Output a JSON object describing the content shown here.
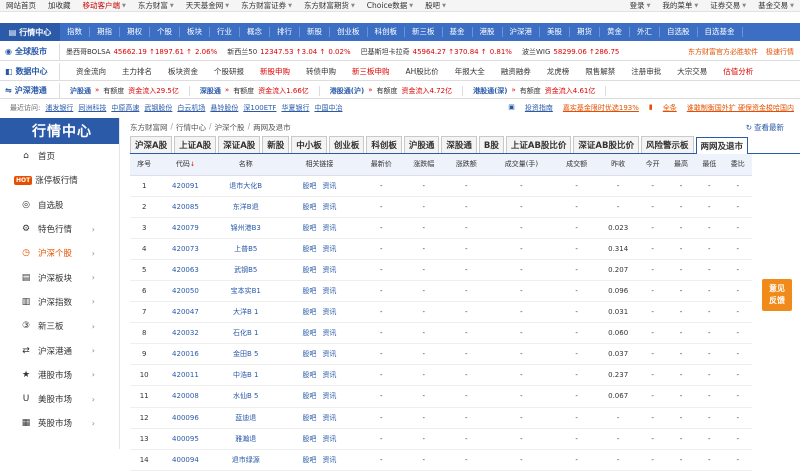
{
  "topbar": {
    "left": [
      "网站首页",
      "加收藏",
      "移动客户端",
      "东方财富",
      "天天基金网",
      "东方财富证券",
      "东方财富期货",
      "Choice数据",
      "股吧"
    ],
    "right": [
      "登录",
      "我的菜单",
      "证券交易",
      "基金交易"
    ]
  },
  "nav": {
    "brand": "行情中心",
    "items": [
      "指数",
      "期指",
      "期权",
      "个股",
      "板块",
      "行业",
      "概念",
      "排行",
      "新股",
      "创业板",
      "科创板",
      "新三板",
      "基金",
      "港股",
      "沪深港",
      "美股",
      "期货",
      "黄金",
      "外汇",
      "自选股",
      "自选基金"
    ]
  },
  "global": {
    "label": "全球股市",
    "tickers": [
      {
        "name": "墨西哥BOLSA",
        "value": "45662.19",
        "chg": "1897.61",
        "pct": "2.06%"
      },
      {
        "name": "新西兰50",
        "value": "12347.53",
        "chg": "3.04",
        "pct": "0.02%"
      },
      {
        "name": "巴基斯坦卡拉奇",
        "value": "45964.27",
        "chg": "370.84",
        "pct": "0.81%"
      },
      {
        "name": "波兰WIG",
        "value": "58299.06",
        "chg": "286.75",
        "pct": ""
      }
    ],
    "promo1": "东方财富官方必胜软件",
    "promo2": "极速行情"
  },
  "datacenter": {
    "label": "数据中心",
    "links": [
      "资金流向",
      "主力排名",
      "板块资金",
      "个股研报",
      "新股申购",
      "转债申购",
      "新三板申购",
      "AH股比价",
      "年报大全",
      "融资融券",
      "龙虎榜",
      "限售解禁",
      "注册审批",
      "大宗交易",
      "估值分析"
    ],
    "red_idx": [
      4,
      6,
      14
    ]
  },
  "hk": {
    "label": "沪深港通",
    "segs": [
      {
        "name": "沪股通",
        "arrow": "»",
        "status": "有额度",
        "flow": "资金流入29.5亿"
      },
      {
        "name": "深股通",
        "arrow": "»",
        "status": "有额度",
        "flow": "资金流入1.66亿"
      },
      {
        "name": "港股通(沪)",
        "arrow": "»",
        "status": "有额度",
        "flow": "资金流入4.72亿"
      },
      {
        "name": "港股通(深)",
        "arrow": "»",
        "status": "有额度",
        "flow": "资金流入4.61亿"
      }
    ]
  },
  "recent": {
    "label": "最近访问:",
    "links": [
      "浦发银行",
      "同洲科技",
      "中原高速",
      "武钢股份",
      "白云机场",
      "悬铃股份",
      "深100ETF",
      "华夏银行",
      "中国中冶"
    ],
    "right1": "投资指南",
    "right2": "嘉实基金限时优选193%",
    "right3": "全条",
    "right4": "谁敢制衡国外扩 硬保资金梭哈国内"
  },
  "sidebar": {
    "title": "行情中心",
    "items": [
      {
        "label": "首页",
        "icon": "home-icon",
        "glyph": "⌂",
        "chev": false
      },
      {
        "label": "涨停板行情",
        "icon": "hot-badge",
        "glyph": "HOT",
        "chev": false
      },
      {
        "label": "自选股",
        "icon": "target-icon",
        "glyph": "◎",
        "chev": false
      },
      {
        "label": "特色行情",
        "icon": "gear-icon",
        "glyph": "⚙",
        "chev": true
      },
      {
        "label": "沪深个股",
        "icon": "clock-icon",
        "glyph": "◷",
        "chev": true
      },
      {
        "label": "沪深板块",
        "icon": "bookmark-icon",
        "glyph": "▤",
        "chev": true
      },
      {
        "label": "沪深指数",
        "icon": "bar-chart-icon",
        "glyph": "▥",
        "chev": true
      },
      {
        "label": "新三板",
        "icon": "circle-3-icon",
        "glyph": "③",
        "chev": true
      },
      {
        "label": "沪深港通",
        "icon": "exchange-icon",
        "glyph": "⇄",
        "chev": true
      },
      {
        "label": "港股市场",
        "icon": "star-icon",
        "glyph": "★",
        "chev": true
      },
      {
        "label": "美股市场",
        "icon": "u-icon",
        "glyph": "U",
        "chev": true
      },
      {
        "label": "英股市场",
        "icon": "grid-icon",
        "glyph": "▦",
        "chev": true
      }
    ],
    "active_index": 4
  },
  "breadcrumb": [
    "东方财富网",
    "行情中心",
    "沪深个股",
    "两网及退市"
  ],
  "refresh": "查看最新",
  "tabs": [
    "沪深A股",
    "上证A股",
    "深证A股",
    "新股",
    "中小板",
    "创业板",
    "科创板",
    "沪股通",
    "深股通",
    "B股",
    "上证AB股比价",
    "深证AB股比价",
    "风险警示板",
    "两网及退市"
  ],
  "active_tab": 13,
  "table": {
    "headers": [
      "序号",
      "代码",
      "名称",
      "相关链接",
      "最新价",
      "涨跌幅",
      "涨跌额",
      "成交量(手)",
      "成交额",
      "昨收",
      "今开",
      "最高",
      "最低",
      "委比"
    ],
    "sort_mark": "↓",
    "link_labels": [
      "股吧",
      "资讯"
    ],
    "rows": [
      [
        "1",
        "420091",
        "退市大化B",
        "-",
        "-",
        "-",
        "-",
        "-",
        "-",
        "-",
        "-",
        "-",
        "-"
      ],
      [
        "2",
        "420085",
        "东洋B退",
        "-",
        "-",
        "-",
        "-",
        "-",
        "-",
        "-",
        "-",
        "-",
        "-"
      ],
      [
        "3",
        "420079",
        "锦州港B3",
        "-",
        "-",
        "-",
        "-",
        "-",
        "0.023",
        "-",
        "-",
        "-",
        "-"
      ],
      [
        "4",
        "420073",
        "上普B5",
        "-",
        "-",
        "-",
        "-",
        "-",
        "0.314",
        "-",
        "-",
        "-",
        "-"
      ],
      [
        "5",
        "420063",
        "武钢B5",
        "-",
        "-",
        "-",
        "-",
        "-",
        "0.207",
        "-",
        "-",
        "-",
        "-"
      ],
      [
        "6",
        "420050",
        "宝本实B1",
        "-",
        "-",
        "-",
        "-",
        "-",
        "0.096",
        "-",
        "-",
        "-",
        "-"
      ],
      [
        "7",
        "420047",
        "大洋B 1",
        "-",
        "-",
        "-",
        "-",
        "-",
        "0.031",
        "-",
        "-",
        "-",
        "-"
      ],
      [
        "8",
        "420032",
        "石化B 1",
        "-",
        "-",
        "-",
        "-",
        "-",
        "0.060",
        "-",
        "-",
        "-",
        "-"
      ],
      [
        "9",
        "420016",
        "金田B 5",
        "-",
        "-",
        "-",
        "-",
        "-",
        "0.037",
        "-",
        "-",
        "-",
        "-"
      ],
      [
        "10",
        "420011",
        "中浩B 1",
        "-",
        "-",
        "-",
        "-",
        "-",
        "0.237",
        "-",
        "-",
        "-",
        "-"
      ],
      [
        "11",
        "420008",
        "水仙B 5",
        "-",
        "-",
        "-",
        "-",
        "-",
        "0.067",
        "-",
        "-",
        "-",
        "-"
      ],
      [
        "12",
        "400096",
        "蓝迪退",
        "-",
        "-",
        "-",
        "-",
        "-",
        "-",
        "-",
        "-",
        "-",
        "-"
      ],
      [
        "13",
        "400095",
        "雅瀚退",
        "-",
        "-",
        "-",
        "-",
        "-",
        "-",
        "-",
        "-",
        "-",
        "-"
      ],
      [
        "14",
        "400094",
        "退市绿源",
        "-",
        "-",
        "-",
        "-",
        "-",
        "-",
        "-",
        "-",
        "-",
        "-"
      ]
    ]
  },
  "feedback": [
    "意见",
    "反馈"
  ],
  "colors": {
    "brand": "#2a5aa8",
    "accent": "#e55000",
    "up": "#d00000"
  }
}
